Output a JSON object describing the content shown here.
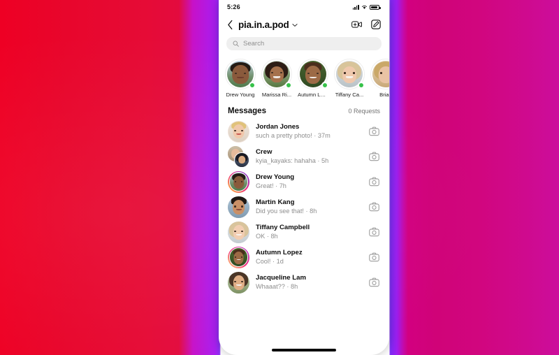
{
  "background": {
    "description": "red-to-magenta gradient backdrop with violet band behind phone",
    "left_color": "#ee0024",
    "mid_color": "#a81ef0",
    "right_color": "#cc0d9c"
  },
  "status_bar": {
    "time": "5:26",
    "icons": [
      "cellular-signal-icon",
      "wifi-icon",
      "battery-icon"
    ]
  },
  "nav": {
    "back_icon": "chevron-left-icon",
    "title": "pia.in.a.pod",
    "dropdown_icon": "chevron-down-icon",
    "video_call_label": "video-call-add",
    "compose_label": "compose-message"
  },
  "search": {
    "placeholder": "Search",
    "value": "",
    "icon": "search-icon"
  },
  "stories": [
    {
      "name": "Drew Young",
      "online": true
    },
    {
      "name": "Marissa Ri...",
      "online": true
    },
    {
      "name": "Autumn Lopez",
      "online": true
    },
    {
      "name": "Tiffany Ca...",
      "online": true
    },
    {
      "name": "Brian",
      "online": false
    }
  ],
  "messages_header": {
    "title": "Messages",
    "requests": "0 Requests"
  },
  "threads": [
    {
      "name": "Jordan Jones",
      "preview": "such a pretty photo! · 37m",
      "ring": "soft",
      "camera_icon": "camera-icon"
    },
    {
      "name": "Crew",
      "preview": "kyia_kayaks: hahaha · 5h",
      "ring": "group",
      "camera_icon": "camera-icon"
    },
    {
      "name": "Drew Young",
      "preview": "Great! · 7h",
      "ring": "story",
      "camera_icon": "camera-icon"
    },
    {
      "name": "Martin Kang",
      "preview": "Did you see that! · 8h",
      "ring": "none",
      "camera_icon": "camera-icon"
    },
    {
      "name": "Tiffany Campbell",
      "preview": "OK · 8h",
      "ring": "none",
      "camera_icon": "camera-icon"
    },
    {
      "name": "Autumn Lopez",
      "preview": "Cool! · 1d",
      "ring": "story",
      "camera_icon": "camera-icon"
    },
    {
      "name": "Jacqueline Lam",
      "preview": "Whaaat?? · 8h",
      "ring": "none",
      "camera_icon": "camera-icon"
    }
  ],
  "home_indicator": "home-indicator"
}
